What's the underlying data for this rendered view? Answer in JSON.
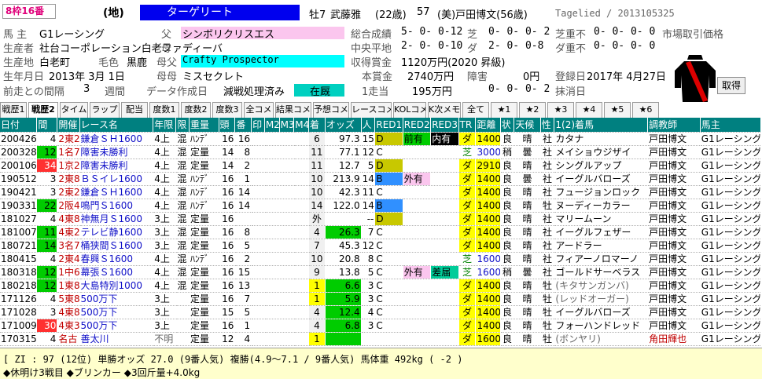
{
  "header": {
    "badge": "8枠16番",
    "chi": "(地)",
    "horse_name": "ターゲリート",
    "sex_age": "牡7",
    "jockey": "武藤雅",
    "jockey_age": "(22歳)",
    "weight": "57",
    "trainer": "(美)戸田博文(56歳)",
    "tag": "Tagelied / 2013105325"
  },
  "profile": {
    "owner_label": "馬 主",
    "owner": "G1レーシング",
    "father_label": "父",
    "father": "シンボリクリスエス",
    "total_label": "総合成績",
    "total": "5- 0- 0-12",
    "turf_label": "芝",
    "turf": "0- 0- 0- 2",
    "turf_heavy_label": "芝重不",
    "turf_heavy": "0- 0- 0- 0",
    "market_label": "市場取引価格",
    "breeder_label": "生産者",
    "breeder": "社台コーポレーション白老ファ",
    "mother_label": "母",
    "mother": "ディーバ",
    "central_label": "中央平地",
    "central": "2- 0- 0-10",
    "dirt_label": "ダ",
    "dirt": "2- 0- 0-8",
    "dirt_heavy_label": "ダ重不",
    "dirt_heavy": "0- 0- 0- 0",
    "birthplace_label": "生産地",
    "birthplace": "白老町",
    "coat_label": "毛色",
    "coat": "黒鹿",
    "mf_label": "母父",
    "mf": "Crafty Prospector",
    "prize_label": "収得賞金",
    "prize": "1120万円(2020 昇級)",
    "birthday_label": "生年月日",
    "birthday": "2013年 3月 1日",
    "mm_label": "母母",
    "mm": "ミスセクレト",
    "money_label": "本賞金",
    "money": "2740万円",
    "obstacle_label": "障害",
    "obstacle_money": "0円",
    "register_label": "登録日",
    "register": "2017年 4月27日",
    "interval_label": "前走との間隔",
    "interval": "3",
    "interval_unit": "週間",
    "datasrc_label": "データ作成日",
    "datasrc": "減戦処理済み",
    "status": "在厩",
    "first_label": "1走当",
    "first": "195万円",
    "obstacle_record": "0- 0- 0- 2",
    "erase_label": "抹消日",
    "get_button": "取得"
  },
  "tabs": [
    "戦歴1",
    "戦歴2",
    "タイム",
    "ラップ",
    "配当",
    "度数1",
    "度数2",
    "度数3",
    "全コメ",
    "結果コメ",
    "予想コメ",
    "レースコメ",
    "KOLコメ",
    "K次メモ",
    "全て",
    "★1",
    "★2",
    "★3",
    "★4",
    "★5",
    "★6"
  ],
  "columns": [
    "日付",
    "間",
    "開催",
    "レース名",
    "年限",
    "限",
    "重量",
    "頭",
    "番",
    "印",
    "M2",
    "M3",
    "M4",
    "着",
    "オッズ",
    "人",
    "RED1",
    "RED2",
    "RED3",
    "TR",
    "距離",
    "状",
    "天候",
    "性",
    "1(2)着馬",
    "調教師",
    "馬主"
  ],
  "rows": [
    [
      "200426",
      "4",
      "2東2",
      "鎌倉ＳＨ1600",
      "4上",
      "混",
      "ﾊﾝﾃﾞ",
      "16",
      "16",
      "",
      "",
      "",
      "",
      "6",
      "97.3",
      "15",
      "D",
      "前有",
      "内有",
      "ダ",
      "1400",
      "良",
      "晴",
      "社",
      "カタナ",
      "戸田博文",
      "G1レーシング"
    ],
    [
      "200328",
      "12",
      "1名7",
      "障害未勝利",
      "4上",
      "混",
      "定量",
      "14",
      "8",
      "",
      "",
      "",
      "",
      "11",
      "77.1",
      "12",
      "C",
      "",
      "",
      "芝",
      "3000",
      "稍",
      "曇",
      "社",
      "メイショウジザイ",
      "戸田博文",
      "G1レーシング"
    ],
    [
      "200106",
      "34",
      "1京2",
      "障害未勝利",
      "4上",
      "混",
      "定量",
      "14",
      "2",
      "",
      "",
      "",
      "",
      "11",
      "12.7",
      "5",
      "D",
      "",
      "",
      "ダ",
      "2910",
      "良",
      "晴",
      "社",
      "シングルアップ",
      "戸田博文",
      "G1レーシング"
    ],
    [
      "190512",
      "3",
      "2東8",
      "ＢＳイレ1600",
      "4上",
      "混",
      "ﾊﾝﾃﾞ",
      "16",
      "1",
      "",
      "",
      "",
      "",
      "10",
      "213.9",
      "14",
      "B",
      "外有",
      "",
      "ダ",
      "1400",
      "良",
      "曇",
      "社",
      "イーグルバローズ",
      "戸田博文",
      "G1レーシング"
    ],
    [
      "190421",
      "3",
      "2東2",
      "鎌倉ＳＨ1600",
      "4上",
      "混",
      "ﾊﾝﾃﾞ",
      "16",
      "14",
      "",
      "",
      "",
      "",
      "10",
      "42.3",
      "11",
      "C",
      "",
      "",
      "ダ",
      "1400",
      "良",
      "晴",
      "社",
      "フュージョンロック",
      "戸田博文",
      "G1レーシング"
    ],
    [
      "190331",
      "22",
      "2阪4",
      "鳴門Ｓ1600",
      "4上",
      "混",
      "ﾊﾝﾃﾞ",
      "16",
      "14",
      "",
      "",
      "",
      "",
      "14",
      "122.0",
      "14",
      "B",
      "",
      "",
      "ダ",
      "1400",
      "良",
      "晴",
      "牡",
      "ヌーディーカラー",
      "戸田博文",
      "G1レーシング"
    ],
    [
      "181027",
      "4",
      "4東8",
      "神無月Ｓ1600",
      "3上",
      "混",
      "定量",
      "16",
      "",
      "",
      "",
      "",
      "",
      "外",
      "",
      "--",
      "D",
      "",
      "",
      "ダ",
      "1400",
      "良",
      "晴",
      "社",
      "マリームーン",
      "戸田博文",
      "G1レーシング"
    ],
    [
      "181007",
      "11",
      "4東2",
      "テレビ静1600",
      "3上",
      "混",
      "定量",
      "16",
      "8",
      "",
      "",
      "",
      "",
      "4",
      "26.3",
      "7",
      "C",
      "",
      "",
      "ダ",
      "1400",
      "良",
      "晴",
      "社",
      "イーグルフェザー",
      "戸田博文",
      "G1レーシング"
    ],
    [
      "180721",
      "14",
      "3名7",
      "桶狭間Ｓ1600",
      "3上",
      "混",
      "定量",
      "16",
      "5",
      "",
      "",
      "",
      "",
      "7",
      "45.3",
      "12",
      "C",
      "",
      "",
      "ダ",
      "1400",
      "良",
      "晴",
      "社",
      "アードラー",
      "戸田博文",
      "G1レーシング"
    ],
    [
      "180415",
      "4",
      "2東4",
      "春興Ｓ1600",
      "4上",
      "混",
      "ﾊﾝﾃﾞ",
      "16",
      "2",
      "",
      "",
      "",
      "",
      "10",
      "20.8",
      "8",
      "C",
      "",
      "",
      "芝",
      "1600",
      "良",
      "晴",
      "社",
      "フィアーノロマーノ",
      "戸田博文",
      "G1レーシング"
    ],
    [
      "180318",
      "12",
      "1中6",
      "幕張Ｓ1600",
      "4上",
      "混",
      "定量",
      "16",
      "15",
      "",
      "",
      "",
      "",
      "9",
      "13.8",
      "5",
      "C",
      "外有",
      "差届",
      "芝",
      "1600",
      "稍",
      "曇",
      "社",
      "ゴールドサーベラス",
      "戸田博文",
      "G1レーシング"
    ],
    [
      "180218",
      "12",
      "1東8",
      "大島特別1000",
      "4上",
      "混",
      "定量",
      "16",
      "13",
      "",
      "",
      "",
      "",
      "1",
      "6.6",
      "3",
      "C",
      "",
      "",
      "ダ",
      "1400",
      "良",
      "晴",
      "牡",
      "(キタサンガンバ)",
      "戸田博文",
      "G1レーシング"
    ],
    [
      "171126",
      "4",
      "5東8",
      "500万下",
      "3上",
      "",
      "定量",
      "16",
      "7",
      "",
      "",
      "",
      "",
      "1",
      "5.9",
      "3",
      "C",
      "",
      "",
      "ダ",
      "1400",
      "良",
      "晴",
      "牡",
      "(レッドオーガー)",
      "戸田博文",
      "G1レーシング"
    ],
    [
      "171028",
      "3",
      "4東8",
      "500万下",
      "3上",
      "",
      "定量",
      "15",
      "5",
      "",
      "",
      "",
      "",
      "4",
      "12.4",
      "4",
      "C",
      "",
      "",
      "ダ",
      "1400",
      "良",
      "晴",
      "牡",
      "イーグルバローズ",
      "戸田博文",
      "G1レーシング"
    ],
    [
      "171009",
      "30",
      "4東3",
      "500万下",
      "3上",
      "",
      "定量",
      "16",
      "1",
      "",
      "",
      "",
      "",
      "4",
      "6.8",
      "3",
      "C",
      "",
      "",
      "ダ",
      "1400",
      "良",
      "晴",
      "牡",
      "フォーハンドレッド",
      "戸田博文",
      "G1レーシング"
    ],
    [
      "170315",
      "4",
      "名古",
      "善太川",
      "不明",
      "",
      "定量",
      "12",
      "4",
      "",
      "",
      "",
      "",
      "1",
      "",
      "",
      "",
      "",
      "",
      "ダ",
      "1600",
      "良",
      "晴",
      "牡",
      "(ボンヤリ)",
      "角田輝也",
      "G1レーシング"
    ]
  ],
  "footer": {
    "line1": "[ ZI :    97 (12位)     単勝オッズ  27.0 (9番人気)    複勝(4.9～7.1 / 9番人気)    馬体重 492kg ( -2 )",
    "line2": "◆休明け3戦目  ◆ブリンカー   ◆3回斤量+4.0kg"
  },
  "colors": {
    "accent": "#0000ee",
    "header_bg": "#008080",
    "win": "#ffff00",
    "green_gap": "#00cc00",
    "red_gap": "#ff3030"
  }
}
